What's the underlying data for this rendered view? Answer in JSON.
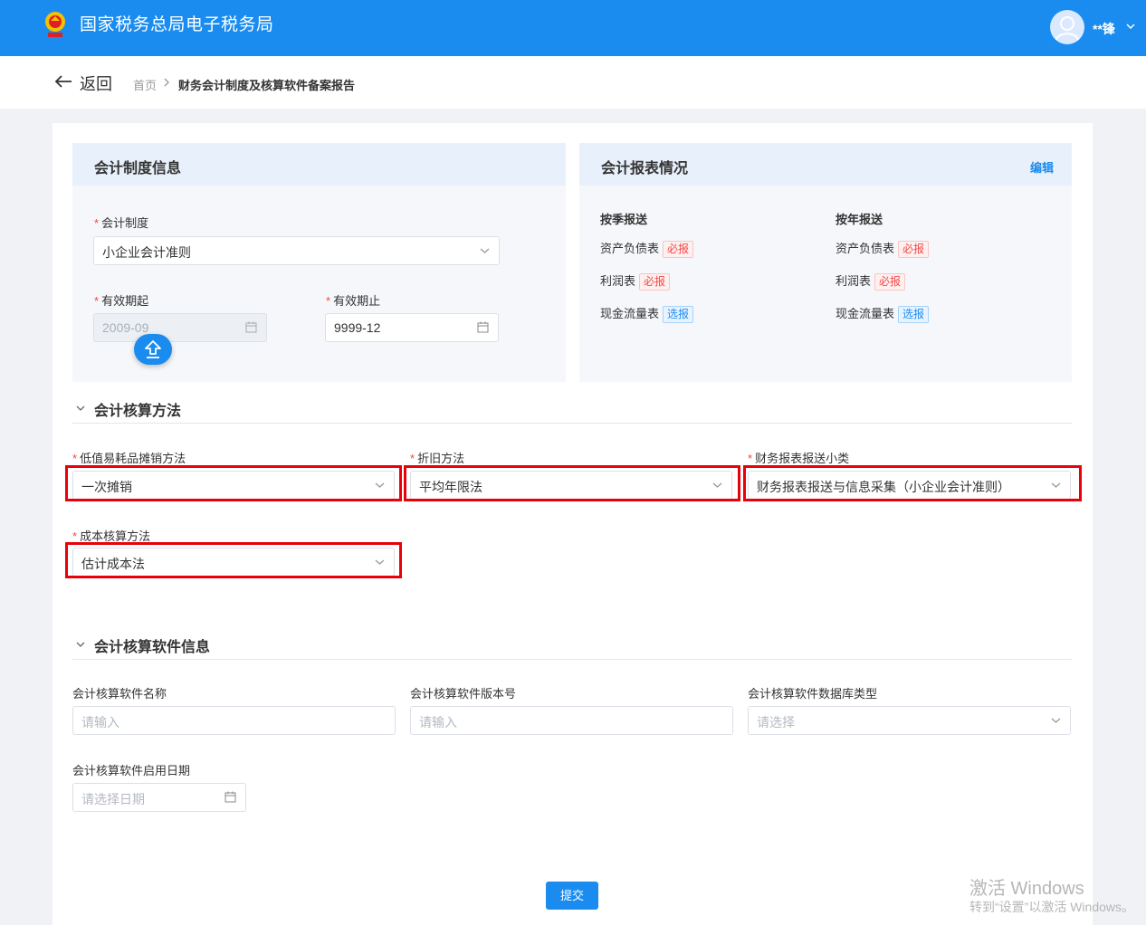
{
  "header": {
    "title": "国家税务总局电子税务局",
    "user_name": "**锋"
  },
  "nav": {
    "back_label": "返回",
    "breadcrumb_home": "首页",
    "breadcrumb_current": "财务会计制度及核算软件备案报告"
  },
  "accounting_system": {
    "title": "会计制度信息",
    "system_label": "会计制度",
    "system_value": "小企业会计准则",
    "start_label": "有效期起",
    "start_value": "2009-09",
    "end_label": "有效期止",
    "end_value": "9999-12"
  },
  "reports": {
    "title": "会计报表情况",
    "edit_label": "编辑",
    "quarterly": {
      "heading": "按季报送",
      "items": [
        {
          "name": "资产负债表",
          "tag": "必报",
          "tag_color": "#f04848"
        },
        {
          "name": "利润表",
          "tag": "必报",
          "tag_color": "#f04848"
        },
        {
          "name": "现金流量表",
          "tag": "选报",
          "tag_color": "#1a8cf0"
        }
      ]
    },
    "annual": {
      "heading": "按年报送",
      "items": [
        {
          "name": "资产负债表",
          "tag": "必报",
          "tag_color": "#f04848"
        },
        {
          "name": "利润表",
          "tag": "必报",
          "tag_color": "#f04848"
        },
        {
          "name": "现金流量表",
          "tag": "选报",
          "tag_color": "#1a8cf0"
        }
      ]
    }
  },
  "methods": {
    "title": "会计核算方法",
    "low_value_label": "低值易耗品摊销方法",
    "low_value_value": "一次摊销",
    "depreciation_label": "折旧方法",
    "depreciation_value": "平均年限法",
    "report_type_label": "财务报表报送小类",
    "report_type_value": "财务报表报送与信息采集（小企业会计准则）",
    "cost_label": "成本核算方法",
    "cost_value": "估计成本法"
  },
  "software": {
    "title": "会计核算软件信息",
    "name_label": "会计核算软件名称",
    "name_placeholder": "请输入",
    "version_label": "会计核算软件版本号",
    "version_placeholder": "请输入",
    "db_label": "会计核算软件数据库类型",
    "db_placeholder": "请选择",
    "date_label": "会计核算软件启用日期",
    "date_placeholder": "请选择日期"
  },
  "submit_label": "提交",
  "watermark": {
    "line1": "激活 Windows",
    "line2": "转到“设置”以激活 Windows。"
  },
  "colors": {
    "primary": "#1a8cf0",
    "required_tag": "#f04848",
    "highlight_box": "#e8000b"
  },
  "required_marker": "*"
}
